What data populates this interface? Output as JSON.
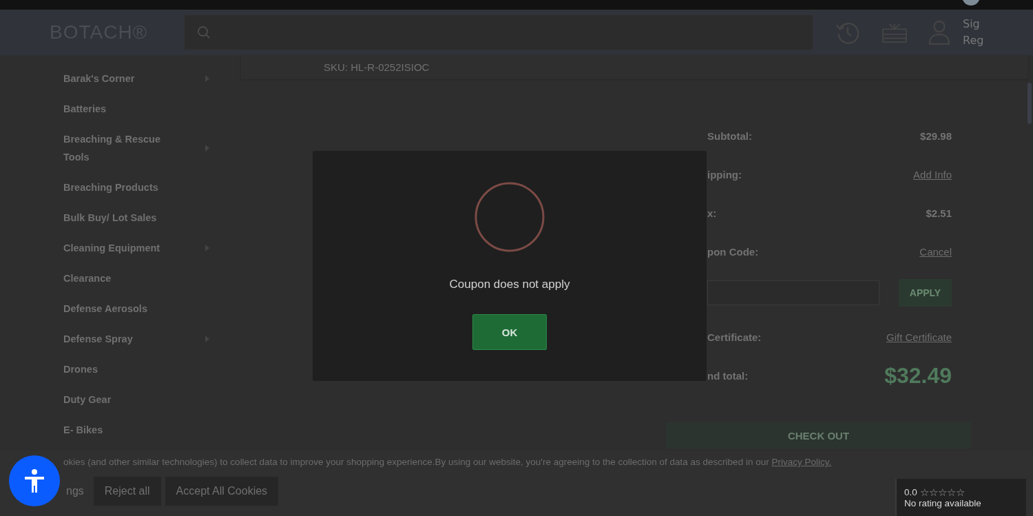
{
  "header": {
    "logo": "BOTACH®",
    "account_lines": [
      "Sig",
      "Reg"
    ]
  },
  "sidebar": {
    "items": [
      {
        "label": "Barak's Corner",
        "has_submenu": true
      },
      {
        "label": "Batteries",
        "has_submenu": false
      },
      {
        "label": "Breaching & Rescue Tools",
        "has_submenu": true
      },
      {
        "label": "Breaching Products",
        "has_submenu": false
      },
      {
        "label": "Bulk Buy/ Lot Sales",
        "has_submenu": false
      },
      {
        "label": "Cleaning Equipment",
        "has_submenu": true
      },
      {
        "label": "Clearance",
        "has_submenu": false
      },
      {
        "label": "Defense Aerosols",
        "has_submenu": false
      },
      {
        "label": "Defense Spray",
        "has_submenu": true
      },
      {
        "label": "Drones",
        "has_submenu": false
      },
      {
        "label": "Duty Gear",
        "has_submenu": false
      },
      {
        "label": "E- Bikes",
        "has_submenu": false
      }
    ]
  },
  "product": {
    "sku_label": "SKU:",
    "sku": "HL-R-0252ISIOC"
  },
  "summary": {
    "rows": [
      {
        "kind": "value",
        "label": "Subtotal:",
        "value": "$29.98"
      },
      {
        "kind": "link",
        "label": "ipping:",
        "value": "Add Info"
      },
      {
        "kind": "value",
        "label": "x:",
        "value": "$2.51"
      },
      {
        "kind": "link",
        "label": "pon Code:",
        "value": "Cancel"
      },
      {
        "kind": "coupon",
        "button": "APPLY"
      },
      {
        "kind": "link",
        "label": "Certificate:",
        "value": "Gift Certificate"
      },
      {
        "kind": "total",
        "label": "nd total:",
        "value": "$32.49"
      }
    ],
    "checkout": "CHECK OUT"
  },
  "cookie_bar": {
    "text": "okies (and other similar technologies) to collect data to improve your shopping experience.By using our website, you're agreeing to the collection of data as described in our",
    "link": "Privacy Policy.",
    "buttons": [
      "ngs",
      "Reject all",
      "Accept All Cookies"
    ]
  },
  "dialog": {
    "message": "Coupon does not apply",
    "button": "OK"
  },
  "rating_badge": {
    "score": "0.0",
    "stars": 0,
    "caption": "No rating available"
  }
}
